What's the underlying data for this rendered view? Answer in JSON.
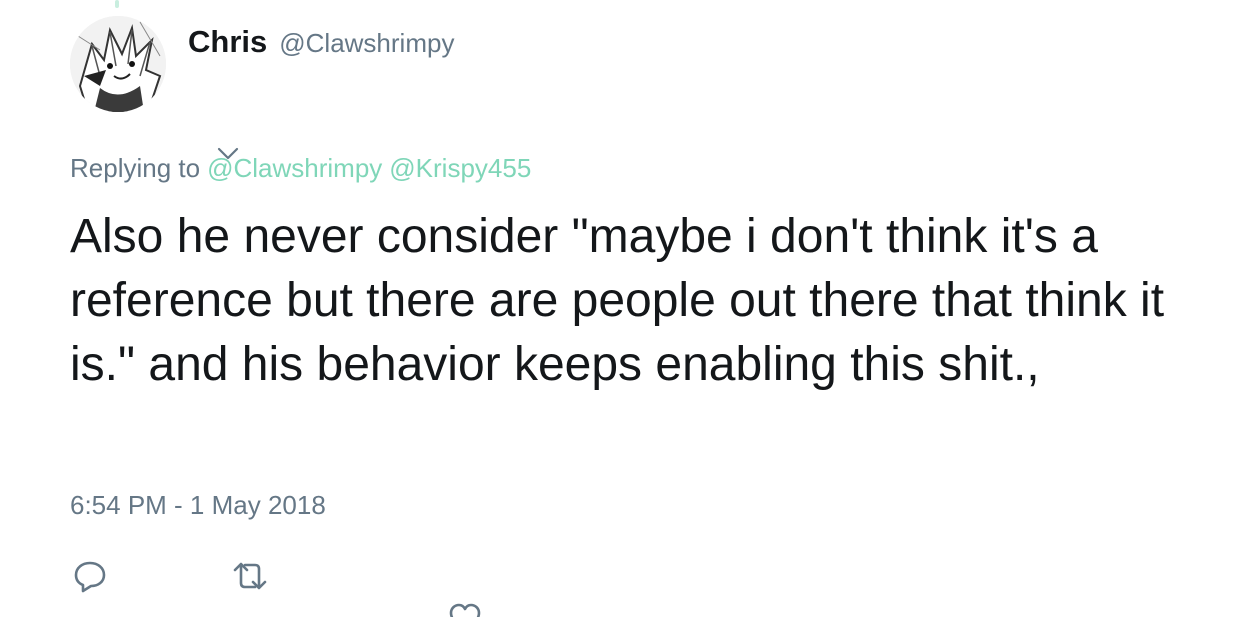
{
  "tweet": {
    "author": {
      "display_name": "Chris",
      "handle": "@Clawshrimpy",
      "avatar_icon": "anime-avatar"
    },
    "reply": {
      "prefix": "Replying to",
      "mentions": [
        "@Clawshrimpy",
        "@Krispy455"
      ]
    },
    "text": "Also he never consider \"maybe i don't think it's a reference but there are people out there that think it is.\" and his behavior keeps enabling this shit.,",
    "timestamp": "6:54 PM - 1 May 2018",
    "actions": [
      "reply-icon",
      "retweet-icon",
      "like-icon"
    ]
  },
  "colors": {
    "text": "#14171a",
    "secondary": "#657786",
    "mention": "#7fd6b8",
    "icon": "#657786"
  }
}
